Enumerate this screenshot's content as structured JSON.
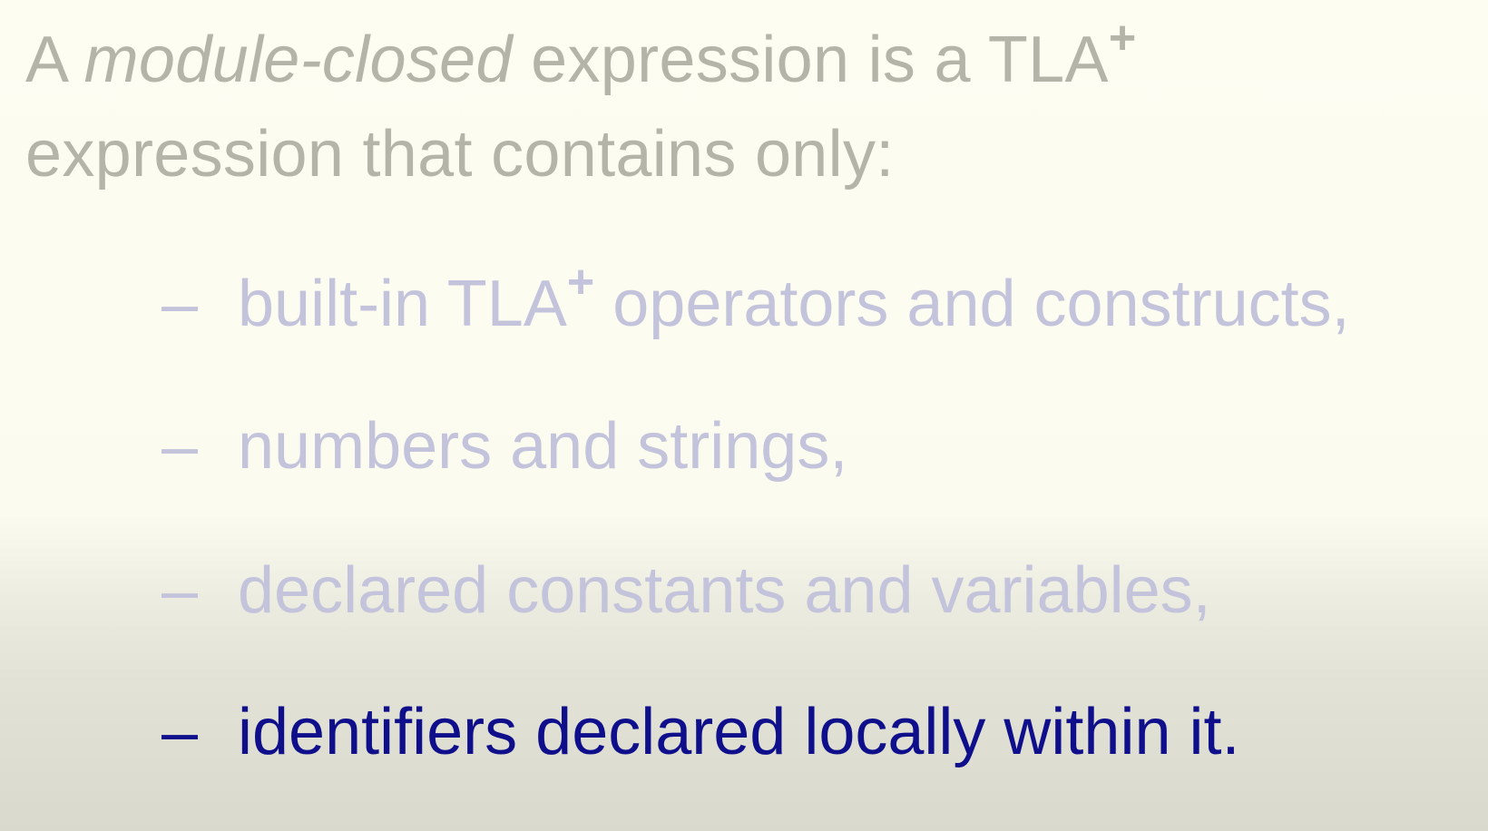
{
  "intro": {
    "prefix": "A ",
    "emphasis": "module-closed",
    "middle": " expression is a TLA",
    "superscript": "+",
    "line2": "expression that contains only:"
  },
  "bullets": [
    {
      "dash": "–",
      "before": "built-in TLA",
      "superscript": "+",
      "after": " operators and constructs,",
      "state": "faded"
    },
    {
      "dash": "–",
      "text": "numbers and strings,",
      "state": "faded"
    },
    {
      "dash": "–",
      "text": "declared constants and variables,",
      "state": "faded"
    },
    {
      "dash": "–",
      "text": "identifiers declared locally within it.",
      "state": "active"
    }
  ],
  "colors": {
    "intro_text": "#b4b4a8",
    "faded_bullet": "#c3c3dc",
    "active_bullet": "#0f0f8c",
    "background": "#fdfdf2"
  }
}
